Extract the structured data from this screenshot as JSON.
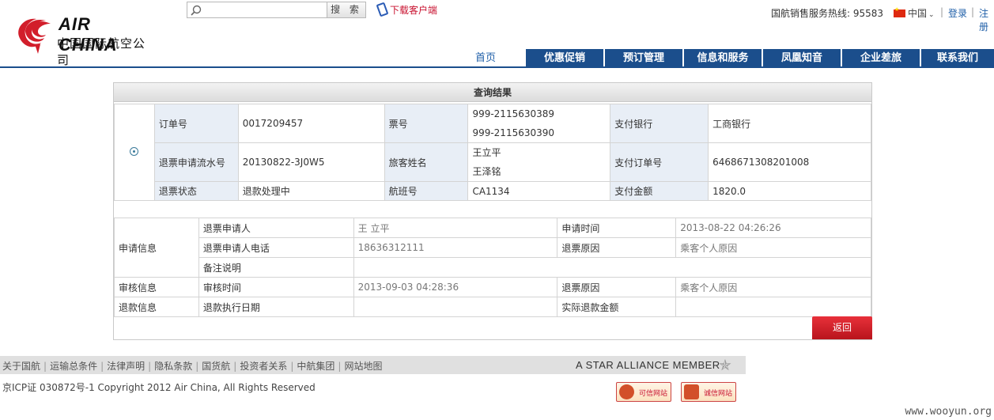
{
  "header": {
    "logo_en": "AIR CHINA",
    "logo_cn": "中国国际航空公司",
    "search_button": "搜 索",
    "download_client": "下载客户端",
    "hotline": "国航销售服务热线: 95583",
    "region": "中国",
    "login": "登录",
    "register": "注册"
  },
  "nav": {
    "items": [
      "首页",
      "优惠促销",
      "预订管理",
      "信息和服务",
      "凤凰知音",
      "企业差旅",
      "联系我们"
    ]
  },
  "result": {
    "title": "查询结果",
    "order_no_label": "订单号",
    "order_no": "0017209457",
    "ticket_no_label": "票号",
    "ticket_no_1": "999-2115630389",
    "ticket_no_2": "999-2115630390",
    "pay_bank_label": "支付银行",
    "pay_bank": "工商银行",
    "refund_serial_label": "退票申请流水号",
    "refund_serial": "20130822-3J0W5",
    "passenger_label": "旅客姓名",
    "passenger_1": "王立平",
    "passenger_2": "王泽铭",
    "pay_order_label": "支付订单号",
    "pay_order": "6468671308201008",
    "refund_status_label": "退票状态",
    "refund_status": "退款处理中",
    "flight_label": "航班号",
    "flight": "CA1134",
    "pay_amount_label": "支付金额",
    "pay_amount": "1820.0"
  },
  "detail": {
    "apply_info": "申请信息",
    "applicant_label": "退票申请人",
    "applicant": "王 立平",
    "apply_time_label": "申请时间",
    "apply_time": "2013-08-22 04:26:26",
    "applicant_phone_label": "退票申请人电话",
    "applicant_phone": "18636312111",
    "refund_reason_label": "退票原因",
    "refund_reason": "乘客个人原因",
    "remark_label": "备注说明",
    "remark": "",
    "review_info": "审核信息",
    "review_time_label": "审核时间",
    "review_time": "2013-09-03 04:28:36",
    "review_reason_label": "退票原因",
    "review_reason": "乘客个人原因",
    "refund_info": "退款信息",
    "refund_date_label": "退款执行日期",
    "refund_date": "",
    "actual_amount_label": "实际退款金额",
    "actual_amount": ""
  },
  "back_button": "返回",
  "footer": {
    "links": [
      "关于国航",
      "运输总条件",
      "法律声明",
      "隐私条款",
      "国货航",
      "投资者关系",
      "中航集团",
      "网站地图"
    ],
    "star_alliance": "A STAR ALLIANCE MEMBER",
    "copyright": "京ICP证 030872号-1 Copyright 2012 Air China, All Rights Reserved",
    "badge_1": "可信网站",
    "badge_2": "诚信网站",
    "watermark": "www.wooyun.org"
  }
}
